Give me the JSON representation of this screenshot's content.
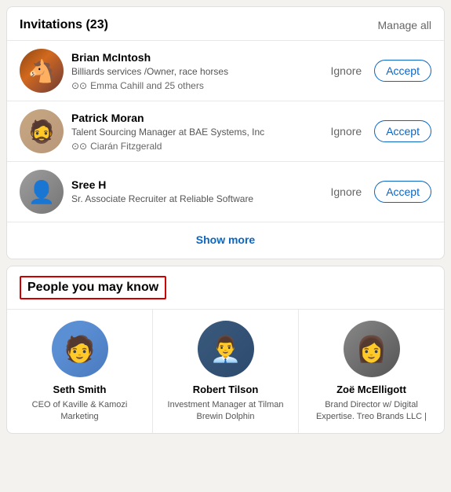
{
  "invitations": {
    "title": "Invitations",
    "count": "(23)",
    "manage_all": "Manage all",
    "items": [
      {
        "id": "brian",
        "name": "Brian McIntosh",
        "role": "Billiards services /Owner, race horses",
        "mutual": "Emma Cahill and 25 others",
        "avatar_type": "horse"
      },
      {
        "id": "patrick",
        "name": "Patrick Moran",
        "role": "Talent Sourcing Manager at BAE Systems, Inc",
        "mutual": "Ciarán Fitzgerald",
        "avatar_type": "sunglasses"
      },
      {
        "id": "sree",
        "name": "Sree H",
        "role": "Sr. Associate Recruiter at Reliable Software",
        "mutual": "",
        "avatar_type": "sree"
      }
    ],
    "ignore_label": "Ignore",
    "accept_label": "Accept",
    "show_more": "Show more"
  },
  "pymk": {
    "title": "People you may know",
    "people": [
      {
        "id": "seth",
        "name": "Seth Smith",
        "role": "CEO of Kaville & Kamozi Marketing",
        "avatar_type": "seth"
      },
      {
        "id": "robert",
        "name": "Robert Tilson",
        "role": "Investment Manager at Tilman Brewin Dolphin",
        "avatar_type": "robert"
      },
      {
        "id": "zoe",
        "name": "Zoë McElligott",
        "role": "Brand Director w/ Digital Expertise. Treo Brands LLC |",
        "avatar_type": "zoe"
      }
    ]
  }
}
